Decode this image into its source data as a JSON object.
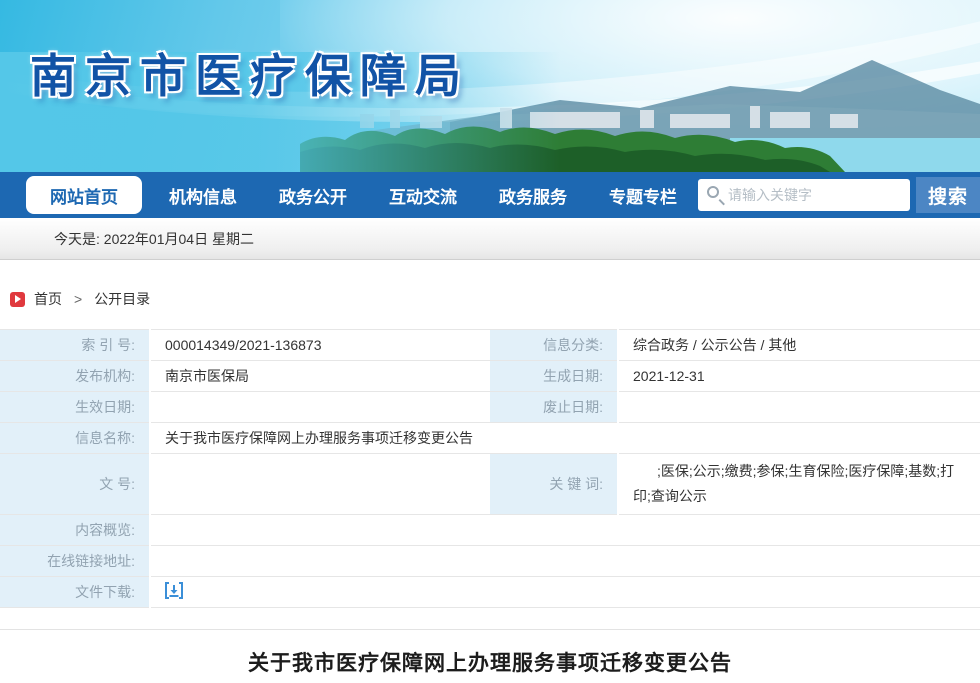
{
  "banner": {
    "site_title": "南京市医疗保障局"
  },
  "nav": {
    "items": [
      {
        "label": "网站首页",
        "active": true
      },
      {
        "label": "机构信息",
        "active": false
      },
      {
        "label": "政务公开",
        "active": false
      },
      {
        "label": "互动交流",
        "active": false
      },
      {
        "label": "政务服务",
        "active": false
      },
      {
        "label": "专题专栏",
        "active": false
      }
    ],
    "search_placeholder": "请输入关键字",
    "search_button": "搜索"
  },
  "date_bar": {
    "text": "今天是:  2022年01月04日  星期二"
  },
  "breadcrumb": {
    "home": "首页",
    "separator": ">",
    "current": "公开目录"
  },
  "info_table": {
    "index_label": "索 引 号:",
    "index_value": "000014349/2021-136873",
    "category_label": "信息分类:",
    "category_value": "综合政务  /  公示公告  /  其他",
    "publisher_label": "发布机构:",
    "publisher_value": "南京市医保局",
    "created_label": "生成日期:",
    "created_value": "2021-12-31",
    "effective_label": "生效日期:",
    "effective_value": "",
    "abolished_label": "废止日期:",
    "abolished_value": "",
    "name_label": "信息名称:",
    "name_value": "关于我市医疗保障网上办理服务事项迁移变更公告",
    "docnum_label": "文      号:",
    "docnum_value": "",
    "keywords_label": "关 键 词:",
    "keywords_value": ";医保;公示;缴费;参保;生育保险;医疗保障;基数;打印;查询公示",
    "overview_label": "内容概览:",
    "overview_value": "",
    "link_label": "在线链接地址:",
    "link_value": "",
    "download_label": "文件下载:"
  },
  "article": {
    "title": "关于我市医疗保障网上办理服务事项迁移变更公告"
  },
  "colors": {
    "nav_blue": "#1d68b2",
    "search_button_blue": "#4c86c4",
    "banner_title_blue": "#1153a6",
    "label_cell_bg": "#e2f0f9",
    "label_text_gray": "#92a3b1",
    "breadcrumb_icon_red": "#e0393e",
    "download_icon_blue": "#3b8fd8"
  }
}
